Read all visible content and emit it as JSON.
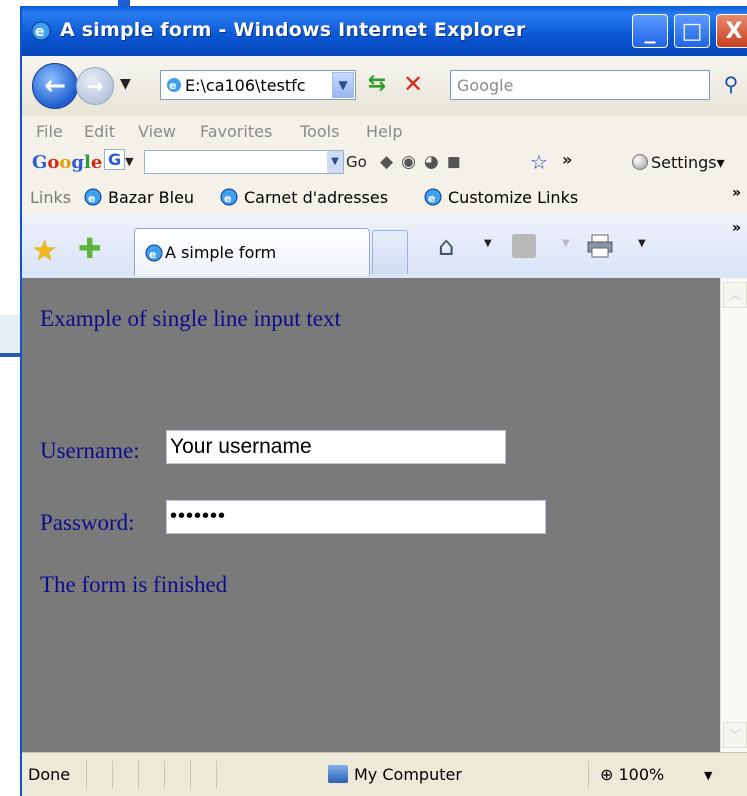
{
  "window": {
    "title": "A simple form - Windows Internet Explorer",
    "minimize": "_",
    "maximize": "□",
    "close": "X"
  },
  "address_bar": {
    "url": "E:\\ca106\\testfc",
    "search_placeholder": "Google"
  },
  "menu": [
    "File",
    "Edit",
    "View",
    "Favorites",
    "Tools",
    "Help"
  ],
  "google_toolbar": {
    "logo": "Google",
    "button": "G",
    "go": "Go",
    "more": "»",
    "settings": "Settings"
  },
  "links_bar": {
    "label": "Links",
    "items": [
      "Bazar Bleu",
      "Carnet d'adresses",
      "Customize Links"
    ],
    "more": "»"
  },
  "tabs": {
    "active": "A simple form",
    "more": "»"
  },
  "page": {
    "heading": "Example of single line input text",
    "username_label": "Username:",
    "username_value": "Your username",
    "password_label": "Password:",
    "password_value": "•••••••",
    "footer": "The form is finished"
  },
  "status": {
    "text": "Done",
    "zone": "My Computer",
    "zoom": "100%"
  },
  "colors": {
    "titlebar": "#0a57d4",
    "content_bg": "#7a7a7a",
    "content_text": "#0d0d8c"
  }
}
